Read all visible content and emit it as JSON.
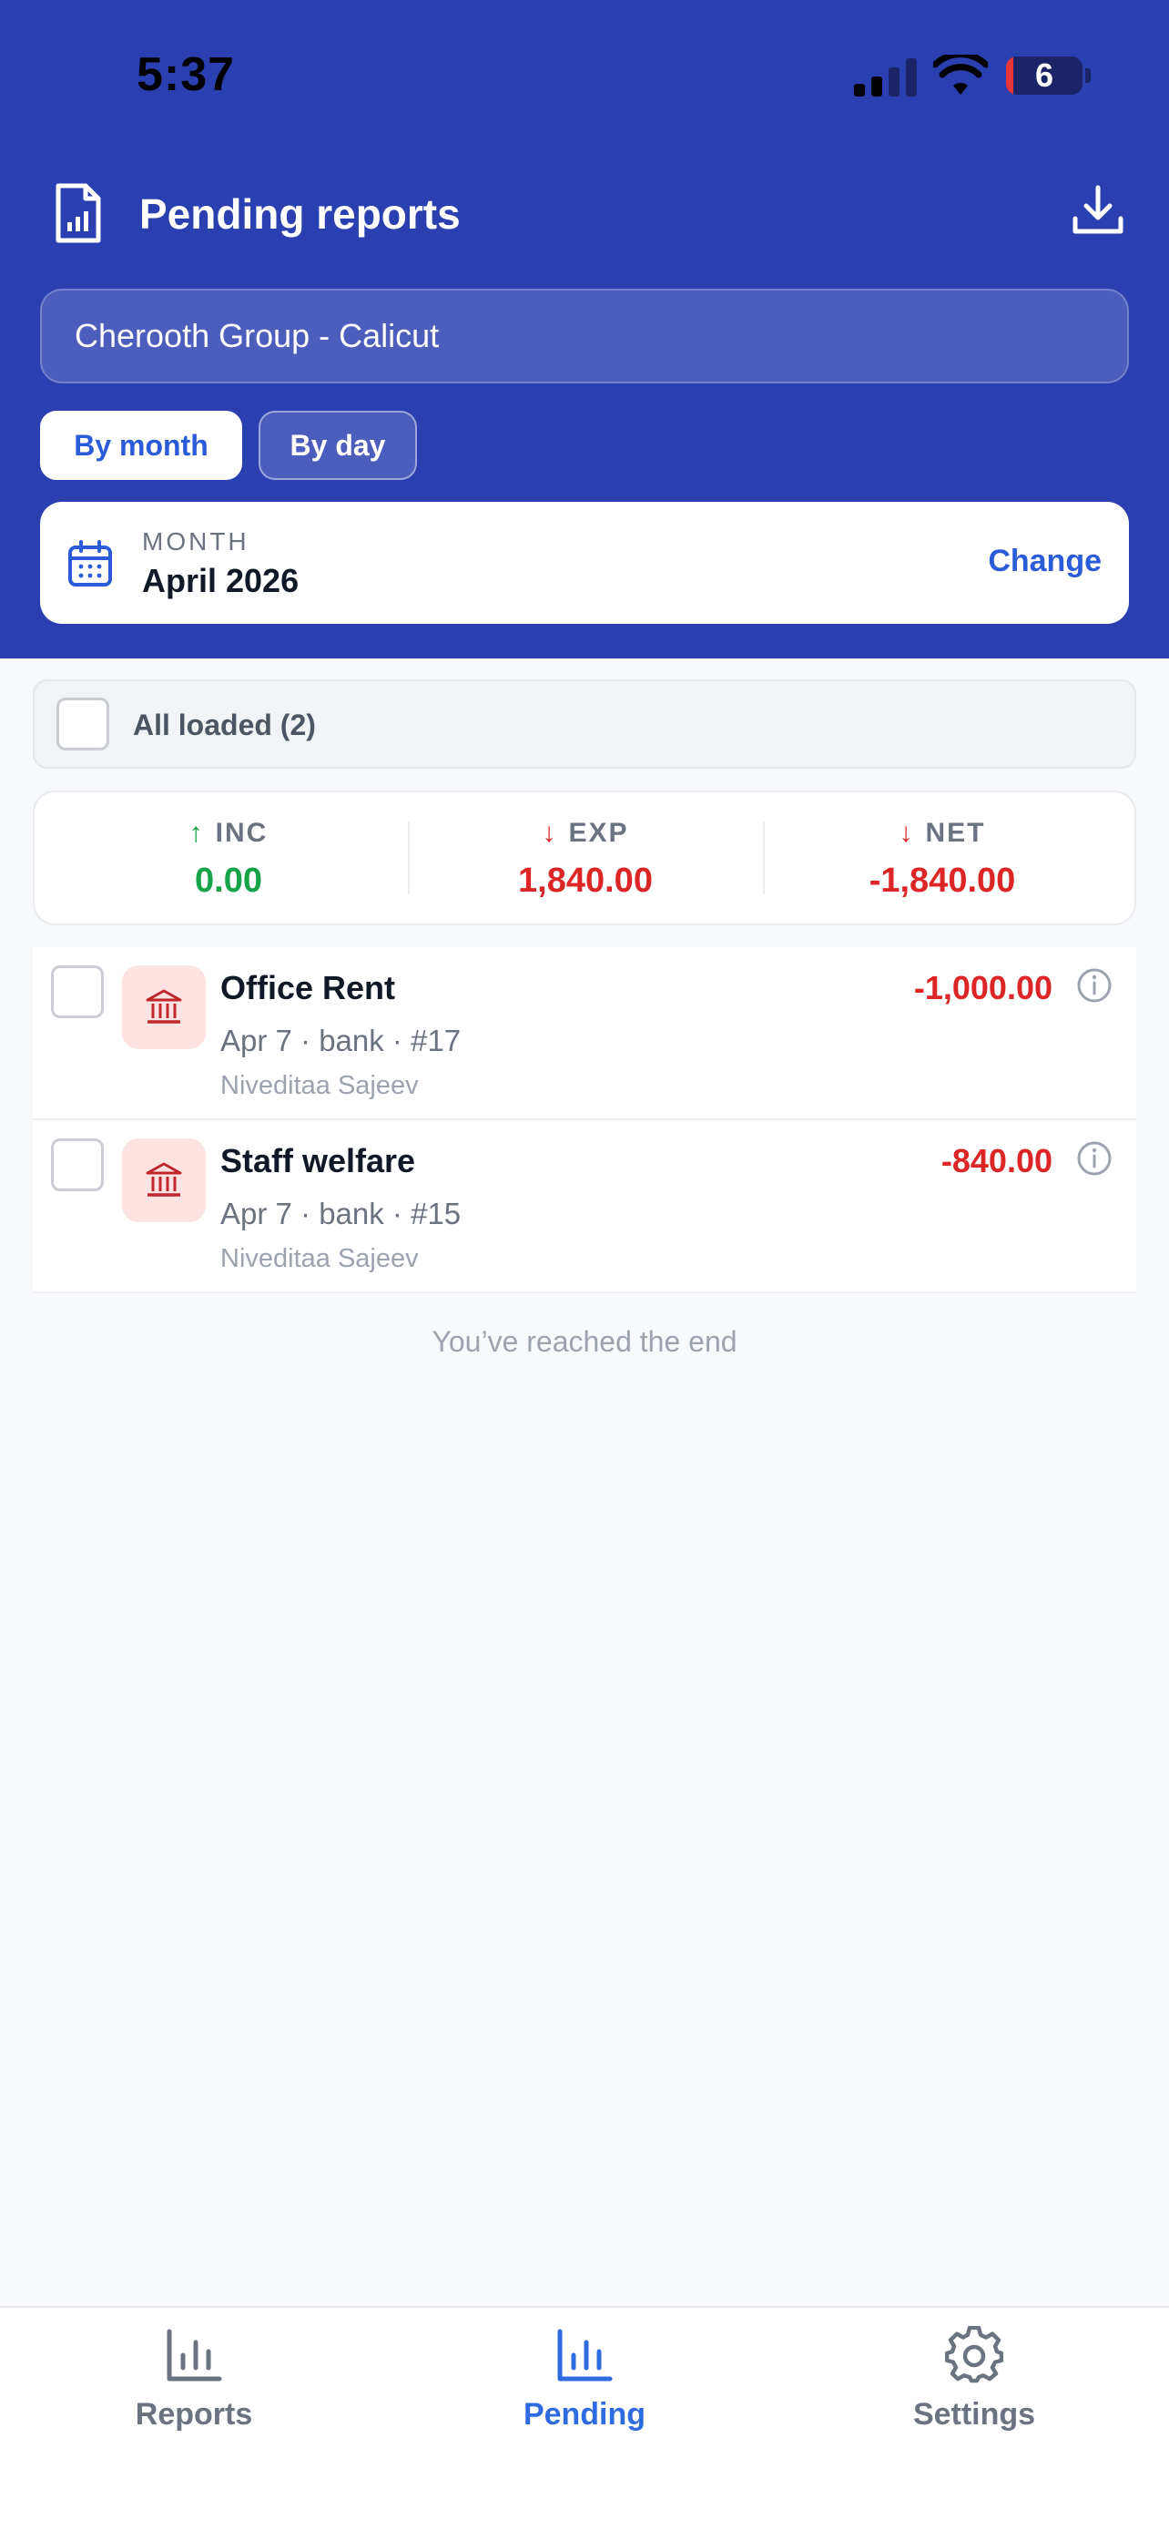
{
  "status_bar": {
    "time": "5:37",
    "battery": "6"
  },
  "header": {
    "title": "Pending reports",
    "company": "Cherooth Group  - Calicut",
    "segments": [
      {
        "label": "By month",
        "active": true
      },
      {
        "label": "By day",
        "active": false
      }
    ],
    "month_card": {
      "label": "MONTH",
      "value": "April 2026",
      "change_label": "Change"
    }
  },
  "all_loaded": {
    "label": "All loaded (2)",
    "checked": false
  },
  "summary": {
    "income": {
      "label": "INC",
      "value": "0.00"
    },
    "expense": {
      "label": "EXP",
      "value": "1,840.00"
    },
    "net": {
      "label": "NET",
      "value": "-1,840.00"
    }
  },
  "entries": [
    {
      "title": "Office Rent",
      "meta": "Apr 7 · bank · #17",
      "user": "Niveditaa Sajeev",
      "amount": "-1,000.00"
    },
    {
      "title": "Staff welfare",
      "meta": "Apr 7 · bank · #15",
      "user": "Niveditaa Sajeev",
      "amount": "-840.00"
    }
  ],
  "end_text": "You’ve reached the end",
  "tabs": [
    {
      "label": "Reports",
      "icon": "bar-chart-icon",
      "active": false
    },
    {
      "label": "Pending",
      "icon": "bar-chart-icon",
      "active": true
    },
    {
      "label": "Settings",
      "icon": "gear-icon",
      "active": false
    }
  ],
  "colors": {
    "header_blue": "#2a3fb0",
    "accent_blue": "#2a5bd8",
    "income_green": "#16a34a",
    "expense_red": "#dc2626"
  }
}
